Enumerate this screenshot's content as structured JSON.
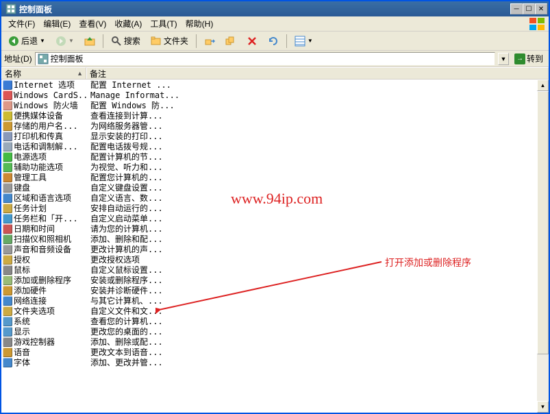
{
  "window": {
    "title": "控制面板"
  },
  "menus": {
    "file": "文件(F)",
    "edit": "编辑(E)",
    "view": "查看(V)",
    "favorites": "收藏(A)",
    "tools": "工具(T)",
    "help": "帮助(H)"
  },
  "toolbar": {
    "back": "后退",
    "search": "搜索",
    "folders": "文件夹"
  },
  "addressbar": {
    "label": "地址(D)",
    "value": "控制面板",
    "go": "转到"
  },
  "columns": {
    "name": "名称",
    "desc": "备注"
  },
  "watermark": "www.94ip.com",
  "callout": "打开添加或删除程序",
  "items": [
    {
      "name": "Internet 选项",
      "desc": "配置 Internet ...",
      "color": "#3a7bd5"
    },
    {
      "name": "Windows CardS...",
      "desc": "Manage Informat...",
      "color": "#d55"
    },
    {
      "name": "Windows 防火墙",
      "desc": "配置 Windows 防...",
      "color": "#d98"
    },
    {
      "name": "便携媒体设备",
      "desc": "查看连接到计算...",
      "color": "#cb3"
    },
    {
      "name": "存储的用户名...",
      "desc": "为网络服务器管...",
      "color": "#c93"
    },
    {
      "name": "打印机和传真",
      "desc": "显示安装的打印...",
      "color": "#89b"
    },
    {
      "name": "电话和调制解...",
      "desc": "配置电话拨号规...",
      "color": "#9ab"
    },
    {
      "name": "电源选项",
      "desc": "配置计算机的节...",
      "color": "#4b4"
    },
    {
      "name": "辅助功能选项",
      "desc": "为视觉、听力和...",
      "color": "#5b5"
    },
    {
      "name": "管理工具",
      "desc": "配置您计算机的...",
      "color": "#c83"
    },
    {
      "name": "键盘",
      "desc": "自定义键盘设置...",
      "color": "#999"
    },
    {
      "name": "区域和语言选项",
      "desc": "自定义语言、数...",
      "color": "#48c"
    },
    {
      "name": "任务计划",
      "desc": "安排自动运行的...",
      "color": "#ca4"
    },
    {
      "name": "任务栏和「开...",
      "desc": "自定义启动菜单...",
      "color": "#49c"
    },
    {
      "name": "日期和时间",
      "desc": "请为您的计算机...",
      "color": "#c55"
    },
    {
      "name": "扫描仪和照相机",
      "desc": "添加、删除和配...",
      "color": "#6a6"
    },
    {
      "name": "声音和音频设备",
      "desc": "更改计算机的声...",
      "color": "#999"
    },
    {
      "name": "授权",
      "desc": "更改授权选项",
      "color": "#ca4"
    },
    {
      "name": "鼠标",
      "desc": "自定义鼠标设置...",
      "color": "#888"
    },
    {
      "name": "添加或删除程序",
      "desc": "安装或删除程序...",
      "color": "#9b7"
    },
    {
      "name": "添加硬件",
      "desc": "安装并诊断硬件...",
      "color": "#c93"
    },
    {
      "name": "网络连接",
      "desc": "与其它计算机、...",
      "color": "#48c"
    },
    {
      "name": "文件夹选项",
      "desc": "自定义文件和文...",
      "color": "#ca4"
    },
    {
      "name": "系统",
      "desc": "查看您的计算机...",
      "color": "#59c"
    },
    {
      "name": "显示",
      "desc": "更改您的桌面的...",
      "color": "#59c"
    },
    {
      "name": "游戏控制器",
      "desc": "添加、删除或配...",
      "color": "#888"
    },
    {
      "name": "语音",
      "desc": "更改文本到语音...",
      "color": "#c93"
    },
    {
      "name": "字体",
      "desc": "添加、更改并管...",
      "color": "#48c"
    }
  ]
}
